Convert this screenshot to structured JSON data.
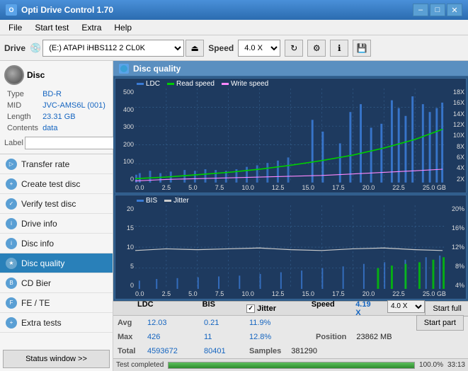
{
  "window": {
    "title": "Opti Drive Control 1.70",
    "icon": "O"
  },
  "titlebar": {
    "minimize": "–",
    "maximize": "□",
    "close": "✕"
  },
  "menu": {
    "items": [
      "File",
      "Start test",
      "Extra",
      "Help"
    ]
  },
  "toolbar": {
    "drive_label": "Drive",
    "drive_value": "(E:) ATAPI iHBS112  2 CL0K",
    "speed_label": "Speed",
    "speed_value": "4.0 X"
  },
  "disc": {
    "type_label": "Type",
    "type_value": "BD-R",
    "mid_label": "MID",
    "mid_value": "JVC-AMS6L (001)",
    "length_label": "Length",
    "length_value": "23.31 GB",
    "contents_label": "Contents",
    "contents_value": "data",
    "label_label": "Label",
    "label_value": ""
  },
  "sidebar_nav": {
    "items": [
      {
        "id": "transfer-rate",
        "label": "Transfer rate",
        "active": false
      },
      {
        "id": "create-test-disc",
        "label": "Create test disc",
        "active": false
      },
      {
        "id": "verify-test-disc",
        "label": "Verify test disc",
        "active": false
      },
      {
        "id": "drive-info",
        "label": "Drive info",
        "active": false
      },
      {
        "id": "disc-info",
        "label": "Disc info",
        "active": false
      },
      {
        "id": "disc-quality",
        "label": "Disc quality",
        "active": true
      },
      {
        "id": "cd-bier",
        "label": "CD Bier",
        "active": false
      },
      {
        "id": "fe-te",
        "label": "FE / TE",
        "active": false
      },
      {
        "id": "extra-tests",
        "label": "Extra tests",
        "active": false
      }
    ],
    "status_btn": "Status window >>"
  },
  "chart": {
    "title": "Disc quality",
    "chart1": {
      "legend": [
        {
          "label": "LDC",
          "color": "#3a7bd5"
        },
        {
          "label": "Read speed",
          "color": "#00cc00"
        },
        {
          "label": "Write speed",
          "color": "#ff88ff"
        }
      ],
      "y_axis_left": [
        "500",
        "400",
        "300",
        "200",
        "100",
        "0"
      ],
      "y_axis_right": [
        "18X",
        "16X",
        "14X",
        "12X",
        "10X",
        "8X",
        "6X",
        "4X",
        "2X"
      ],
      "x_axis": [
        "0.0",
        "2.5",
        "5.0",
        "7.5",
        "10.0",
        "12.5",
        "15.0",
        "17.5",
        "20.0",
        "22.5",
        "25.0 GB"
      ]
    },
    "chart2": {
      "legend": [
        {
          "label": "BIS",
          "color": "#3a7bd5"
        },
        {
          "label": "Jitter",
          "color": "#cccccc"
        }
      ],
      "y_axis_left": [
        "20",
        "15",
        "10",
        "5",
        "0"
      ],
      "y_axis_right": [
        "20%",
        "16%",
        "12%",
        "8%",
        "4%"
      ],
      "x_axis": [
        "0.0",
        "2.5",
        "5.0",
        "7.5",
        "10.0",
        "12.5",
        "15.0",
        "17.5",
        "20.0",
        "22.5",
        "25.0 GB"
      ]
    }
  },
  "stats": {
    "col1_header": "LDC",
    "col2_header": "BIS",
    "col3_header": "Jitter",
    "col4_header": "Speed",
    "col4_value": "4.19 X",
    "col5_header": "4.0 X",
    "avg_label": "Avg",
    "avg_ldc": "12.03",
    "avg_bis": "0.21",
    "avg_jitter": "11.9%",
    "max_label": "Max",
    "max_ldc": "426",
    "max_bis": "11",
    "max_jitter": "12.8%",
    "max_pos_label": "Position",
    "max_pos_val": "23862 MB",
    "total_label": "Total",
    "total_ldc": "4593672",
    "total_bis": "80401",
    "total_samples_label": "Samples",
    "total_samples_val": "381290",
    "start_full": "Start full",
    "start_part": "Start part"
  },
  "statusbar": {
    "text": "Test completed",
    "progress": 100,
    "progress_text": "100.0%",
    "time": "33:13"
  }
}
